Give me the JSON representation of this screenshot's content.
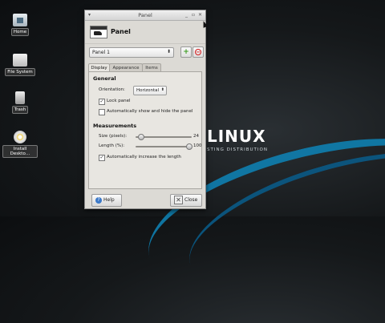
{
  "desktop": {
    "icons": [
      {
        "label": "Home",
        "icon": "home-folder-icon"
      },
      {
        "label": "File System",
        "icon": "drive-icon"
      },
      {
        "label": "Trash",
        "icon": "trash-icon"
      },
      {
        "label": "Install Deskto…",
        "icon": "disc-icon"
      }
    ],
    "wallpaper": {
      "title": "LINUX",
      "subtitle": "STING DISTRIBUTION"
    }
  },
  "window": {
    "title": "Panel",
    "header_title": "Panel",
    "panel_select": "Panel 1",
    "add_label": "+",
    "remove_label": "−",
    "tabs": [
      {
        "label": "Display",
        "active": true
      },
      {
        "label": "Appearance",
        "active": false
      },
      {
        "label": "Items",
        "active": false
      }
    ],
    "general": {
      "heading": "General",
      "orientation_label": "Orientation:",
      "orientation_value": "Horizontal",
      "lock_label": "Lock panel",
      "lock_checked": true,
      "autohide_label": "Automatically show and hide the panel",
      "autohide_checked": false
    },
    "measurements": {
      "heading": "Measurements",
      "size_label": "Size (pixels):",
      "size_value": "24",
      "length_label": "Length (%):",
      "length_value": "100",
      "autolength_label": "Automatically increase the length",
      "autolength_checked": true
    },
    "help_label": "Help",
    "close_label": "Close"
  },
  "colors": {
    "accent": "#0f7fb0",
    "add": "#3a9a1e",
    "remove": "#d21a1a"
  }
}
